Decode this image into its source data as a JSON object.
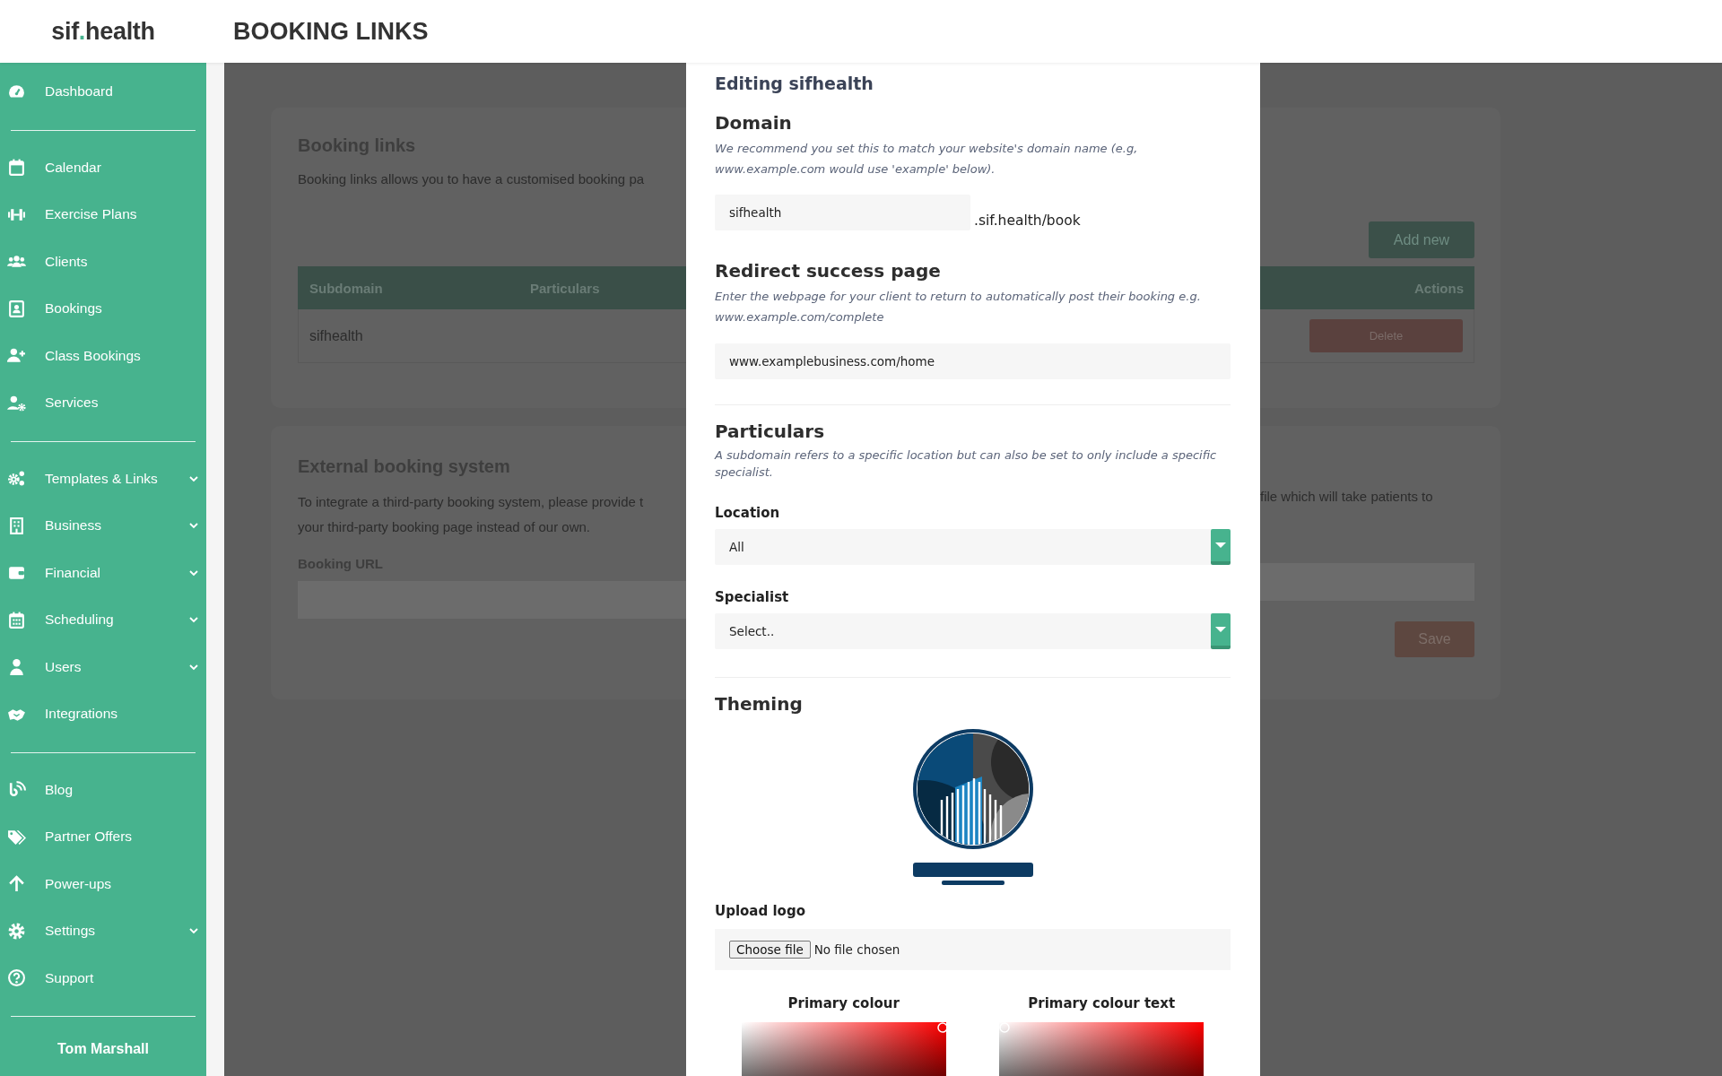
{
  "header": {
    "logo": {
      "before": "sif",
      "dot": ".",
      "after": "health"
    },
    "title": "BOOKING LINKS"
  },
  "sidebar": {
    "groups": [
      [
        {
          "label": "Dashboard",
          "expandable": false
        }
      ],
      [
        {
          "label": "Calendar",
          "expandable": false
        },
        {
          "label": "Exercise Plans",
          "expandable": false
        },
        {
          "label": "Clients",
          "expandable": false
        },
        {
          "label": "Bookings",
          "expandable": false
        },
        {
          "label": "Class Bookings",
          "expandable": false
        },
        {
          "label": "Services",
          "expandable": false
        }
      ],
      [
        {
          "label": "Templates & Links",
          "expandable": true
        },
        {
          "label": "Business",
          "expandable": true
        },
        {
          "label": "Financial",
          "expandable": true
        },
        {
          "label": "Scheduling",
          "expandable": true
        },
        {
          "label": "Users",
          "expandable": true
        },
        {
          "label": "Integrations",
          "expandable": false
        }
      ],
      [
        {
          "label": "Blog",
          "expandable": false
        },
        {
          "label": "Partner Offers",
          "expandable": false
        },
        {
          "label": "Power-ups",
          "expandable": false
        },
        {
          "label": "Settings",
          "expandable": true
        },
        {
          "label": "Support",
          "expandable": false
        }
      ]
    ],
    "user": "Tom Marshall"
  },
  "background": {
    "booking_links": {
      "title": "Booking links",
      "description": "Booking links allows you to have a customised booking pa",
      "add_button": "Add new",
      "columns": [
        "Subdomain",
        "Particulars",
        "Actions"
      ],
      "rows": [
        {
          "subdomain": "sifhealth",
          "action": "Delete"
        }
      ]
    },
    "external": {
      "title": "External booking system",
      "description_left": [
        "To integrate a third-party booking system, please provide t",
        "your third-party booking page instead of our own."
      ],
      "description_right": "file which will take patients to",
      "field_label": "Booking URL",
      "save_button": "Save"
    }
  },
  "modal": {
    "title": "Editing sifhealth",
    "domain": {
      "heading": "Domain",
      "help": "We recommend you set this to match your website's domain name (e.g, www.example.com would use 'example' below).",
      "value": "sifhealth",
      "suffix": ".sif.health/book"
    },
    "redirect": {
      "heading": "Redirect success page",
      "help": "Enter the webpage for your client to return to automatically post their booking e.g. www.example.com/complete",
      "value": "www.examplebusiness.com/home"
    },
    "particulars": {
      "heading": "Particulars",
      "help": "A subdomain refers to a specific location but can also be set to only include a specific specialist.",
      "selects": [
        {
          "label": "Location",
          "value": "All"
        },
        {
          "label": "Specialist",
          "value": "Select.."
        }
      ]
    },
    "theming": {
      "heading": "Theming",
      "upload_label": "Upload logo",
      "file_button": "Choose file",
      "file_status": "No file chosen",
      "colour_pickers": [
        {
          "label": "Primary colour"
        },
        {
          "label": "Primary colour text"
        }
      ]
    }
  }
}
